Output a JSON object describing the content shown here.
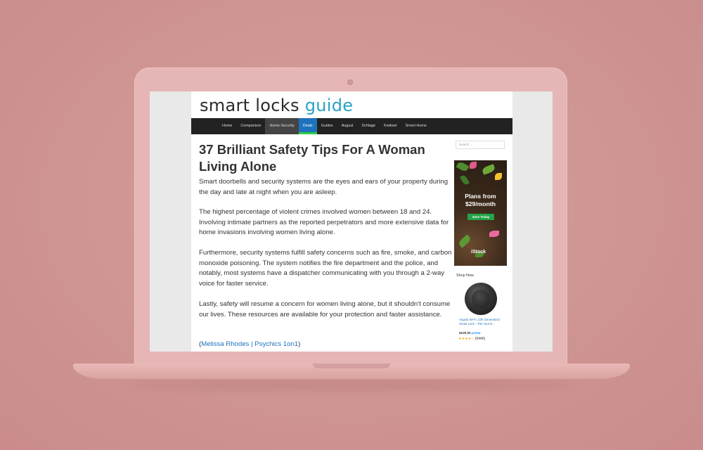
{
  "site": {
    "logo_word1": "smart locks",
    "logo_word2": "guide"
  },
  "nav": {
    "items": [
      "Home",
      "Comparison",
      "Home Security",
      "Deals",
      "Guides",
      "August",
      "Schlage",
      "Kwikset",
      "Smart Home"
    ]
  },
  "article": {
    "title": "37 Brilliant Safety Tips For A Woman Living Alone",
    "paragraphs": [
      "Smart doorbells and security systems are the eyes and ears of your property during the day and late at night when you are asleep.",
      "The highest percentage of violent crimes involved women between 18 and 24. Involving intimate partners as the reported perpetrators and more extensive data for home invasions involving women living alone.",
      "Furthermore, security systems fulfill safety concerns such as fire, smoke, and carbon monoxide poisoning. The system notifies the fire department and the police, and notably, most systems have a dispatcher communicating with you through a 2-way voice for faster service.",
      "Lastly, safety will resume a concern for women living alone, but it shouldn't consume our lives. These resources are available for your protection and faster assistance."
    ],
    "credit_open": "(",
    "credit_link": "Melissa Rhodes | Psychics 1on1",
    "credit_close": ")"
  },
  "sidebar": {
    "search_placeholder": "Search ...",
    "ad": {
      "headline": "Plans from $29/month",
      "button": "Save Today",
      "brand": "iStock"
    },
    "shop_now": "Shop Now",
    "product": {
      "title": "August Wi-Fi, (4th Generation) Smart Lock – Fits Your E...",
      "price": "$229.00",
      "prime": "prime",
      "stars": "★★★★☆",
      "reviews": "(6446)"
    }
  },
  "colors": {
    "accent": "#2aa1c7",
    "nav_bg": "#222222",
    "deals_bg": "#1e73be",
    "deals_underline": "#2ecc40",
    "background": "#d69e9d"
  }
}
